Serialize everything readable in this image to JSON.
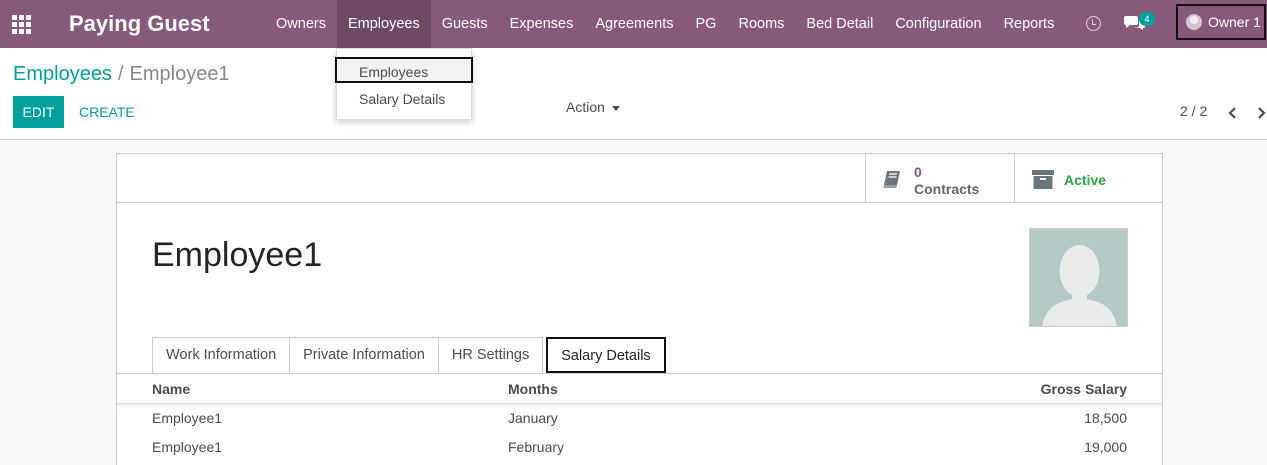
{
  "navbar": {
    "brand": "Paying Guest",
    "menu": [
      "Owners",
      "Employees",
      "Guests",
      "Expenses",
      "Agreements",
      "PG",
      "Rooms",
      "Bed Detail",
      "Configuration",
      "Reports"
    ],
    "chat_count": "4",
    "user_name": "Owner 1"
  },
  "dropdown": {
    "items": [
      "Employees",
      "Salary Details"
    ]
  },
  "control_panel": {
    "breadcrumb_parent": "Employees",
    "breadcrumb_separator": "/",
    "breadcrumb_current": "Employee1",
    "edit_label": "EDIT",
    "create_label": "CREATE",
    "action_label": "Action",
    "pager": "2 / 2"
  },
  "form": {
    "contracts_count": "0",
    "contracts_label": "Contracts",
    "active_label": "Active",
    "employee_name": "Employee1",
    "tabs": [
      "Work Information",
      "Private Information",
      "HR Settings",
      "Salary Details"
    ],
    "table": {
      "headers": [
        "Name",
        "Months",
        "Gross Salary"
      ],
      "rows": [
        [
          "Employee1",
          "January",
          "18,500"
        ],
        [
          "Employee1",
          "February",
          "19,000"
        ]
      ]
    }
  },
  "colors": {
    "navbar": "#875a7b",
    "accent": "#00a09d",
    "active": "#28a745"
  }
}
